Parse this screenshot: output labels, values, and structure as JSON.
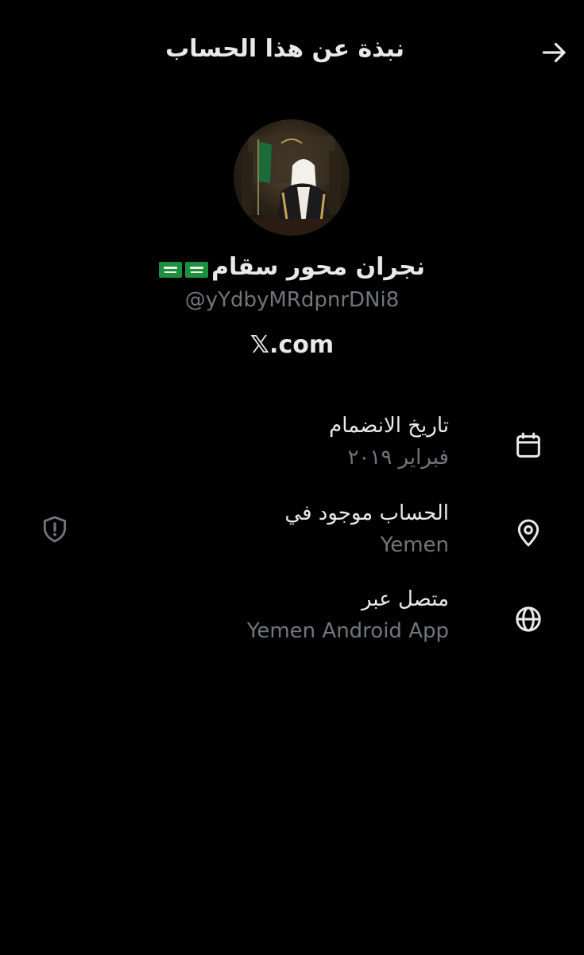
{
  "header": {
    "title": "نبذة عن هذا الحساب",
    "back_icon": "arrow-right-icon"
  },
  "profile": {
    "avatar_icon": "profile-avatar",
    "display_name": "نجران محور سقام",
    "flag_icon": "saudi-flag-icon",
    "handle": "@yYdbyMRdpnrDNi8",
    "platform": "𝕏.com"
  },
  "details": [
    {
      "icon": "calendar-icon",
      "label": "تاريخ الانضمام",
      "value": "فبراير ٢٠١٩"
    },
    {
      "icon": "location-pin-icon",
      "label": "الحساب موجود في",
      "value": "Yemen",
      "extra_icon": "shield-alert-icon"
    },
    {
      "icon": "globe-icon",
      "label": "متصل عبر",
      "value": "Yemen Android App"
    }
  ],
  "colors": {
    "background": "#000000",
    "text_primary": "#e7e9ea",
    "text_secondary": "#71767b",
    "flag_green": "#1e8f3e"
  }
}
